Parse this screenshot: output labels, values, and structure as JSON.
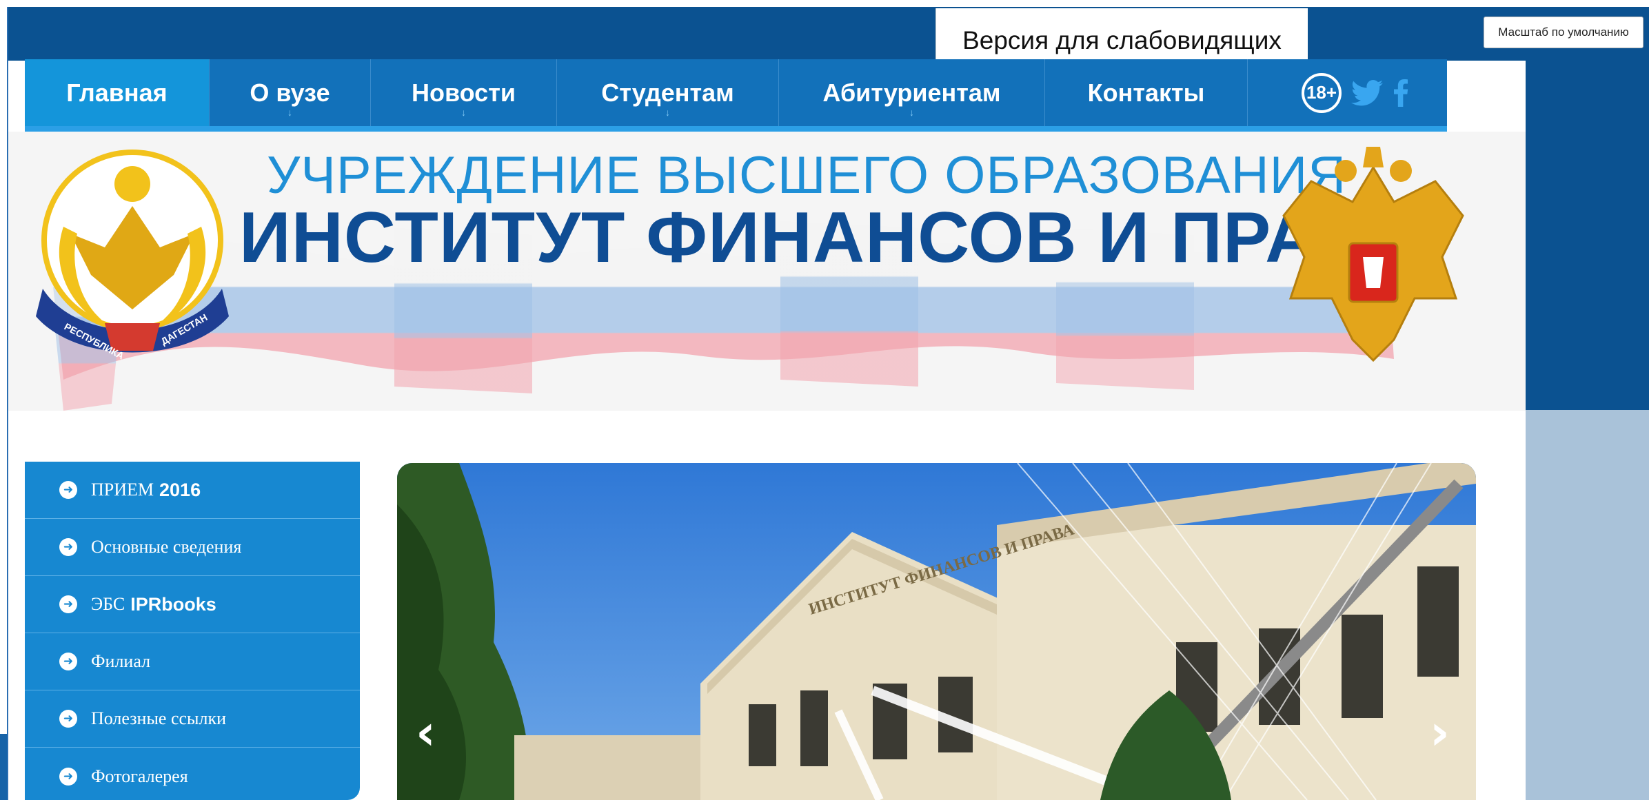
{
  "toolbar": {
    "zoom_label": "Масштаб по умолчанию",
    "vision_label": "Версия для слабовидящих"
  },
  "nav": {
    "items": [
      {
        "label": "Главная",
        "active": true,
        "has_submenu": false
      },
      {
        "label": "О вузе",
        "active": false,
        "has_submenu": true
      },
      {
        "label": "Новости",
        "active": false,
        "has_submenu": true
      },
      {
        "label": "Студентам",
        "active": false,
        "has_submenu": true
      },
      {
        "label": "Абитуриентам",
        "active": false,
        "has_submenu": true
      },
      {
        "label": "Контакты",
        "active": false,
        "has_submenu": false
      }
    ],
    "submenu_marker": "↓",
    "age_rating": "18+",
    "social": [
      "twitter-icon",
      "facebook-icon"
    ]
  },
  "banner": {
    "line1": "УЧРЕЖДЕНИЕ ВЫСШЕГО ОБРАЗОВАНИЯ",
    "line2": "ИНСТИТУТ ФИНАНСОВ И ПРАВА",
    "left_emblem_text": "РЕСПУБЛИКА ДАГЕСТАН"
  },
  "sidebar": {
    "items": [
      {
        "label": "ПРИЕМ",
        "bold": "2016"
      },
      {
        "label": "Основные сведения",
        "bold": ""
      },
      {
        "label": "ЭБС",
        "bold": "IPRbooks"
      },
      {
        "label": "Филиал",
        "bold": ""
      },
      {
        "label": "Полезные ссылки",
        "bold": ""
      },
      {
        "label": "Фотогалерея",
        "bold": ""
      }
    ]
  },
  "slider": {
    "building_sign": "ИНСТИТУТ ФИНАНСОВ И ПРАВА",
    "prev_icon": "chevron-left-icon",
    "next_icon": "chevron-right-icon"
  },
  "colors": {
    "nav_blue": "#1271ba",
    "active_blue": "#1495da",
    "dark_blue": "#0b5291",
    "title_blue": "#0f4d94",
    "subtitle_blue": "#1f8fd6"
  }
}
